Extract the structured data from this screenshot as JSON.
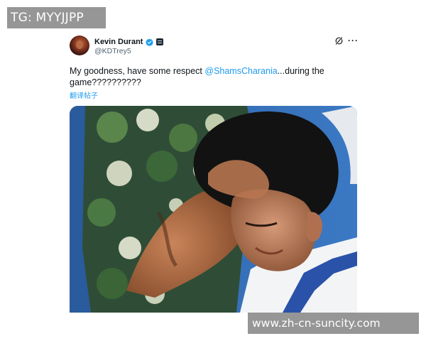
{
  "watermark_top_left": "TG: MYYJJPP",
  "watermark_bottom_right": "www.zh-cn-suncity.com",
  "tweet": {
    "author": {
      "display_name": "Kevin Durant",
      "handle": "@KDTrey5",
      "verified": true,
      "avatar_icon": "avatar"
    },
    "text_before": "My goodness, have some respect ",
    "mention": "@ShamsCharania",
    "text_after": "...during the game??????????",
    "translate_label": "翻译帖子",
    "actions": {
      "grok_icon": "grok-icon",
      "more_icon": "more-icon"
    },
    "media": {
      "description_icon": "video-thumbnail"
    }
  },
  "colors": {
    "link": "#1d9bf0",
    "verified": "#1d9bf0",
    "text": "#0f1419",
    "secondary": "#536471"
  }
}
